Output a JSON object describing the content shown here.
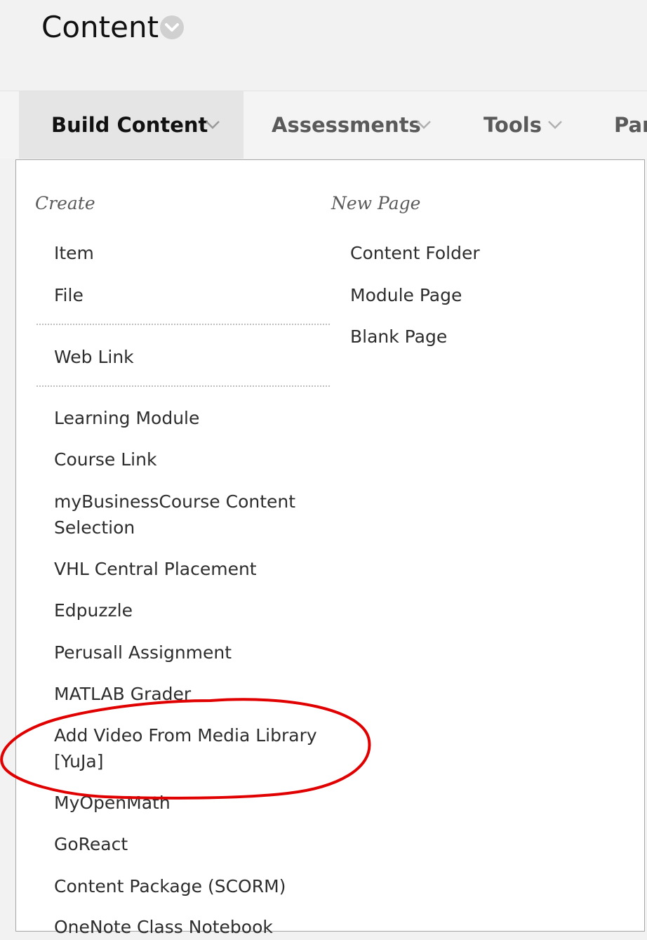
{
  "header": {
    "title": "Content"
  },
  "action_bar": {
    "tabs": [
      {
        "label": "Build Content"
      },
      {
        "label": "Assessments"
      },
      {
        "label": "Tools"
      },
      {
        "label": "Par"
      }
    ]
  },
  "menu": {
    "create": {
      "heading": "Create",
      "items": [
        "Item",
        "File",
        "Web Link",
        "Learning Module",
        "Course Link",
        "myBusinessCourse Content",
        "Selection",
        "VHL Central Placement",
        "Edpuzzle",
        "Perusall Assignment",
        "MATLAB Grader",
        "Add Video From Media Library",
        "[YuJa]",
        "MyOpenMath",
        "GoReact",
        "Content Package (SCORM)",
        "OneNote Class Notebook"
      ]
    },
    "new_page": {
      "heading": "New Page",
      "items": [
        "Content Folder",
        "Module Page",
        "Blank Page"
      ]
    }
  },
  "colors": {
    "annotation": "#e00000",
    "active_tab": "#e5e5e5",
    "panel_border": "#a6a6a6"
  }
}
